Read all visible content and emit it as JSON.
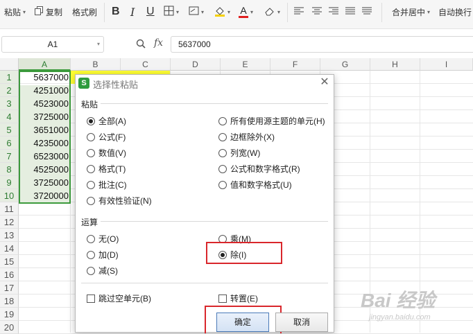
{
  "ribbon": {
    "paste_label": "粘贴",
    "copy_label": "复制",
    "format_painter_label": "格式刷",
    "bold_glyph": "B",
    "italic_glyph": "I",
    "underline_glyph": "U",
    "font_color_glyph": "A",
    "merge_center_label": "合并居中",
    "wrap_label": "自动换行"
  },
  "formula_bar": {
    "name_box": "A1",
    "fx_label": "fx",
    "value": "5637000"
  },
  "sheet": {
    "columns": [
      "A",
      "B",
      "C",
      "D",
      "E",
      "F",
      "G",
      "H",
      "I"
    ],
    "rows": [
      "1",
      "2",
      "3",
      "4",
      "5",
      "6",
      "7",
      "8",
      "9",
      "10",
      "11",
      "12",
      "13",
      "14",
      "15",
      "16",
      "17",
      "18",
      "19",
      "20"
    ],
    "column_a_values": [
      "5637000",
      "4251000",
      "4523000",
      "3725000",
      "3651000",
      "4235000",
      "6523000",
      "4525000",
      "3725000",
      "3720000"
    ]
  },
  "dialog": {
    "title": "选择性粘贴",
    "logo_letter": "S",
    "paste_section": "粘贴",
    "paste_left": [
      "全部(A)",
      "公式(F)",
      "数值(V)",
      "格式(T)",
      "批注(C)",
      "有效性验证(N)"
    ],
    "paste_right": [
      "所有使用源主题的单元(H)",
      "边框除外(X)",
      "列宽(W)",
      "公式和数字格式(R)",
      "值和数字格式(U)"
    ],
    "paste_selected": "全部(A)",
    "operation_section": "运算",
    "op_none": "无(O)",
    "op_add": "加(D)",
    "op_subtract": "减(S)",
    "op_multiply": "乘(M)",
    "op_divide": "除(I)",
    "op_selected": "除(I)",
    "skip_blanks": "跳过空单元(B)",
    "transpose": "转置(E)",
    "ok_label": "确定",
    "cancel_label": "取消"
  },
  "colors": {
    "selection_green": "#3c9a3c",
    "highlight_red": "#d9262b",
    "yellow_fill": "#ffff33"
  },
  "watermark": {
    "brand": "Bai 经验",
    "url": "jingyan.baidu.com"
  }
}
